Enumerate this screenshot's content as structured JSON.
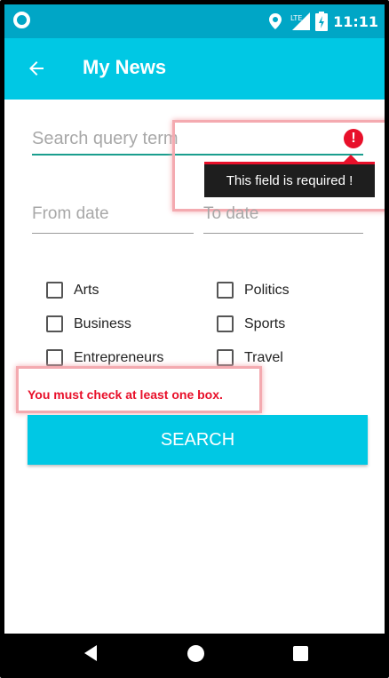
{
  "status_bar": {
    "time": "11:11",
    "network_label": "LTE"
  },
  "app_bar": {
    "title": "My News"
  },
  "search": {
    "placeholder": "Search query term",
    "error_icon_glyph": "!",
    "error_tooltip": "This field is required !"
  },
  "dates": {
    "from_placeholder": "From date",
    "to_placeholder": "To date"
  },
  "categories": [
    "Arts",
    "Business",
    "Entrepreneurs",
    "Politics",
    "Sports",
    "Travel"
  ],
  "checkbox_error": "You must check at least one box.",
  "search_button": {
    "label": "SEARCH"
  },
  "colors": {
    "primary": "#00c8e4",
    "status_bar": "#00a6c6",
    "error": "#e8102a",
    "accent_underline": "#1a9e8e"
  },
  "icons": [
    "back-arrow-icon",
    "location-icon",
    "signal-icon",
    "battery-icon",
    "error-icon",
    "nav-back-icon",
    "nav-home-icon",
    "nav-recents-icon"
  ]
}
